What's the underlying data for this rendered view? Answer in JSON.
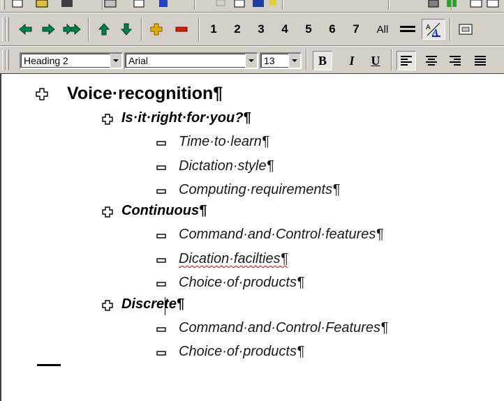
{
  "outline_toolbar": {
    "level_buttons": [
      "1",
      "2",
      "3",
      "4",
      "5",
      "6",
      "7"
    ],
    "show_all_label": "All"
  },
  "formatting_toolbar": {
    "style": "Heading 2",
    "font": "Arial",
    "size": "13",
    "bold_label": "B",
    "italic_label": "I",
    "underline_label": "U"
  },
  "document": {
    "h1": "Voice·recognition¶",
    "sec1_title": "Is·it·right·for·you?¶",
    "sec1_items": [
      "Time·to·learn¶",
      "Dictation·style¶",
      "Computing·requirements¶"
    ],
    "sec2_title": "Continuous¶",
    "sec2_items": [
      "Command·and·Control·features¶",
      "Dication·facilties¶",
      "Choice·of·products¶"
    ],
    "sec3_title": "Discrete¶",
    "sec3_items": [
      "Command·and·Control·Features¶",
      "Choice·of·products¶"
    ]
  },
  "icons": [
    "expand-plus-icon",
    "collapse-minus-icon",
    "promote-arrow-icon",
    "demote-arrow-icon",
    "move-up-icon",
    "move-down-icon"
  ],
  "colors": {
    "toolbar": "#d4d0c8",
    "arrow_green": "#007f4a",
    "expand_yellow": "#b08800",
    "expand_red": "#c00000"
  }
}
